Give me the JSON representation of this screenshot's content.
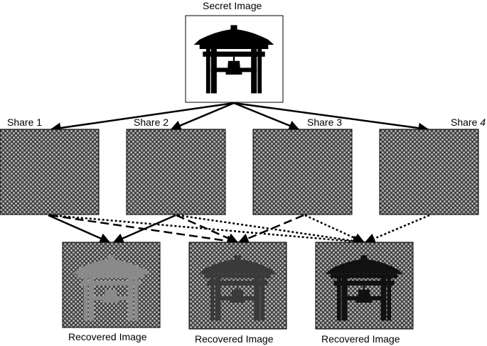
{
  "secret": {
    "label": "Secret Image",
    "icon": "pagoda-bell-icon"
  },
  "shares": [
    {
      "prefix": "Share ",
      "num": "1"
    },
    {
      "prefix": "Share ",
      "num": "2"
    },
    {
      "prefix": "Share ",
      "num": "3"
    },
    {
      "prefix": "Share ",
      "num": "4"
    }
  ],
  "recovered": [
    {
      "label": "Recovered Image",
      "shares_used": 2,
      "icon": "pagoda-bell-icon"
    },
    {
      "label": "Recovered Image",
      "shares_used": 3,
      "icon": "pagoda-bell-icon"
    },
    {
      "label": "Recovered Image",
      "shares_used": 4,
      "icon": "pagoda-bell-icon"
    }
  ],
  "colors": {
    "share_fill": "#5a5a5a",
    "share_dots": "#e6e6e6",
    "recovered_fills": [
      "#8a8a8a",
      "#3a3a3a",
      "#111111"
    ],
    "secret_fill": "#000000"
  }
}
